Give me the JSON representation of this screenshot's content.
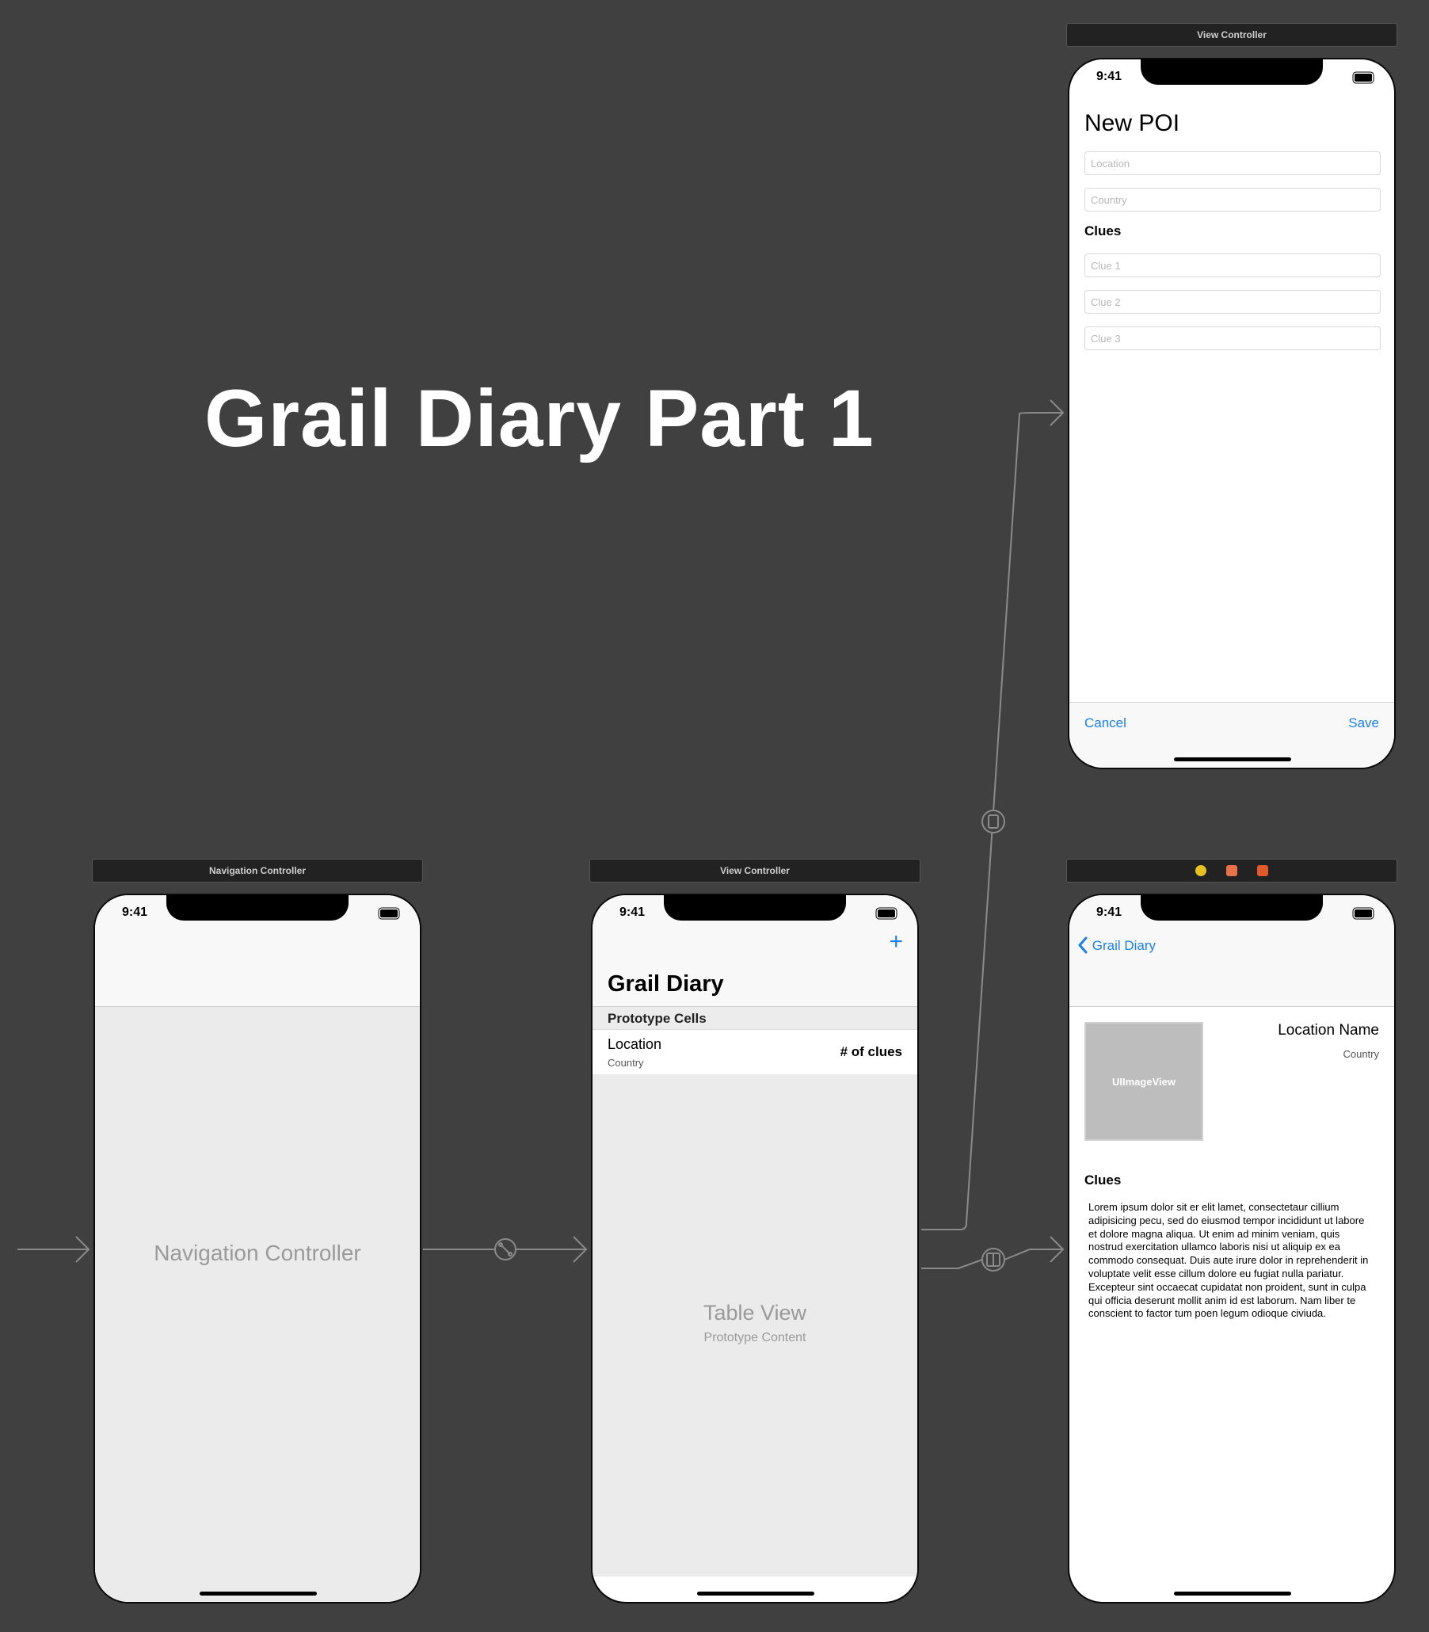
{
  "canvas_title": "Grail Diary Part 1",
  "colors": {
    "canvas": "#404040",
    "ios_blue": "#1a7ff0",
    "connector": "#8a8a8a"
  },
  "status_bar": {
    "time": "9:41"
  },
  "scenes": {
    "navigation_controller": {
      "bar_title": "Navigation Controller",
      "placeholder": "Navigation Controller"
    },
    "list_view_controller": {
      "bar_title": "View Controller",
      "add_icon": "plus-icon",
      "large_title": "Grail Diary",
      "section_header": "Prototype Cells",
      "cell": {
        "title": "Location",
        "subtitle": "Country",
        "detail": "# of clues"
      },
      "table_placeholder": {
        "title": "Table View",
        "subtitle": "Prototype Content"
      }
    },
    "new_poi_view_controller": {
      "bar_title": "View Controller",
      "heading": "New POI",
      "fields": [
        {
          "placeholder": "Location"
        },
        {
          "placeholder": "Country"
        }
      ],
      "clues_label": "Clues",
      "clue_fields": [
        {
          "placeholder": "Clue 1"
        },
        {
          "placeholder": "Clue 2"
        },
        {
          "placeholder": "Clue 3"
        }
      ],
      "cancel": "Cancel",
      "save": "Save"
    },
    "detail_view_controller": {
      "bar_icons": [
        "first-responder-icon",
        "view-controller-icon",
        "exit-icon"
      ],
      "back_label": "Grail Diary",
      "back_icon": "chevron-left-icon",
      "image_placeholder": "UIImageView",
      "location_name": "Location Name",
      "country": "Country",
      "clues_label": "Clues",
      "clues_text": "Lorem ipsum dolor sit er elit lamet, consectetaur cillium adipisicing pecu, sed do eiusmod tempor incididunt ut labore et dolore magna aliqua. Ut enim ad minim veniam, quis nostrud exercitation ullamco laboris nisi ut aliquip ex ea commodo consequat. Duis aute irure dolor in reprehenderit in voluptate velit esse cillum dolore eu fugiat nulla pariatur. Excepteur sint occaecat cupidatat non proident, sunt in culpa qui officia deserunt mollit anim id est laborum. Nam liber te conscient to factor tum poen legum odioque civiuda."
    }
  }
}
